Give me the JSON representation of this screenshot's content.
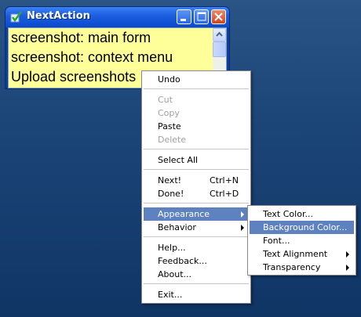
{
  "window": {
    "title": "NextAction",
    "tasks": [
      "screenshot: main form",
      "screenshot: context menu",
      "Upload screenshots"
    ]
  },
  "context_menu": {
    "items": [
      {
        "label": "Undo",
        "enabled": true
      },
      {
        "label": "Cut",
        "enabled": false
      },
      {
        "label": "Copy",
        "enabled": false
      },
      {
        "label": "Paste",
        "enabled": true
      },
      {
        "label": "Delete",
        "enabled": false
      },
      {
        "label": "Select All",
        "enabled": true
      },
      {
        "label": "Next!",
        "shortcut": "Ctrl+N",
        "enabled": true
      },
      {
        "label": "Done!",
        "shortcut": "Ctrl+D",
        "enabled": true
      },
      {
        "label": "Appearance",
        "enabled": true,
        "submenu": true,
        "highlighted": true
      },
      {
        "label": "Behavior",
        "enabled": true,
        "submenu": true
      },
      {
        "label": "Help...",
        "enabled": true
      },
      {
        "label": "Feedback...",
        "enabled": true
      },
      {
        "label": "About...",
        "enabled": true
      },
      {
        "label": "Exit...",
        "enabled": true
      }
    ]
  },
  "appearance_submenu": {
    "items": [
      {
        "label": "Text Color..."
      },
      {
        "label": "Background Color...",
        "highlighted": true
      },
      {
        "label": "Font..."
      },
      {
        "label": "Text Alignment",
        "submenu": true
      },
      {
        "label": "Transparency",
        "submenu": true
      }
    ]
  },
  "colors": {
    "note_background": "#ffff99",
    "menu_highlight": "#5e81bf",
    "title_bar": "#0b49cd"
  }
}
